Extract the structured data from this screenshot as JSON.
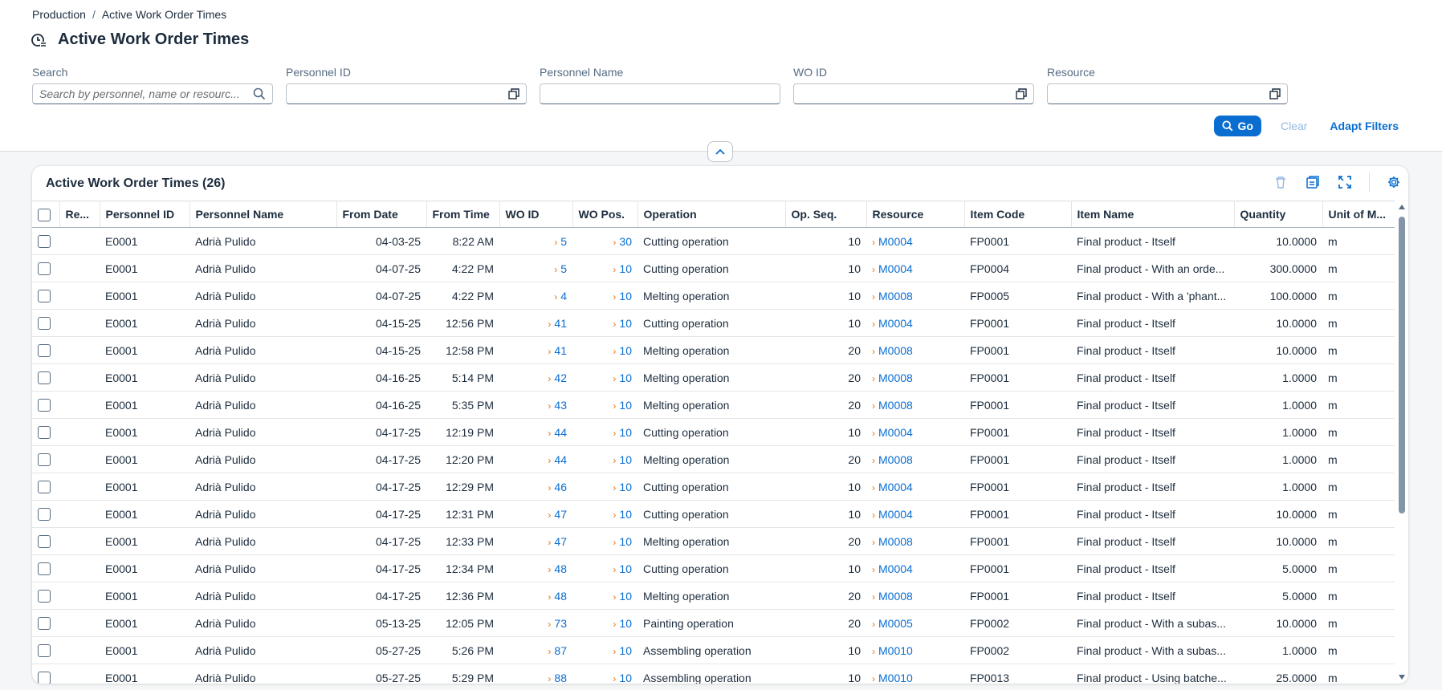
{
  "breadcrumb": {
    "parent": "Production",
    "separator": "/",
    "current": "Active Work Order Times"
  },
  "page": {
    "title": "Active Work Order Times"
  },
  "filters": {
    "search": {
      "label": "Search",
      "placeholder": "Search by personnel, name or resourc..."
    },
    "personnel_id": {
      "label": "Personnel ID",
      "value": ""
    },
    "personnel_name": {
      "label": "Personnel Name",
      "value": ""
    },
    "wo_id": {
      "label": "WO ID",
      "value": ""
    },
    "resource": {
      "label": "Resource",
      "value": ""
    }
  },
  "actions": {
    "go": "Go",
    "clear": "Clear",
    "adapt": "Adapt Filters"
  },
  "table": {
    "title": "Active Work Order Times (26)",
    "columns": [
      "Re...",
      "Personnel ID",
      "Personnel Name",
      "From Date",
      "From Time",
      "WO ID",
      "WO Pos.",
      "Operation",
      "Op. Seq.",
      "Resource",
      "Item Code",
      "Item Name",
      "Quantity",
      "Unit of M..."
    ],
    "rows": [
      {
        "re": "",
        "pid": "E0001",
        "pname": "Adrià Pulido",
        "date": "04-03-25",
        "time": "8:22 AM",
        "wo": "5",
        "pos": "30",
        "op": "Cutting operation",
        "seq": "10",
        "res": "M0004",
        "code": "FP0001",
        "item": "Final product - Itself",
        "qty": "10.0000",
        "uom": "m"
      },
      {
        "re": "",
        "pid": "E0001",
        "pname": "Adrià Pulido",
        "date": "04-07-25",
        "time": "4:22 PM",
        "wo": "5",
        "pos": "10",
        "op": "Cutting operation",
        "seq": "10",
        "res": "M0004",
        "code": "FP0004",
        "item": "Final product - With an orde...",
        "qty": "300.0000",
        "uom": "m"
      },
      {
        "re": "",
        "pid": "E0001",
        "pname": "Adrià Pulido",
        "date": "04-07-25",
        "time": "4:22 PM",
        "wo": "4",
        "pos": "10",
        "op": "Melting operation",
        "seq": "10",
        "res": "M0008",
        "code": "FP0005",
        "item": "Final product - With a 'phant...",
        "qty": "100.0000",
        "uom": "m"
      },
      {
        "re": "",
        "pid": "E0001",
        "pname": "Adrià Pulido",
        "date": "04-15-25",
        "time": "12:56 PM",
        "wo": "41",
        "pos": "10",
        "op": "Cutting operation",
        "seq": "10",
        "res": "M0004",
        "code": "FP0001",
        "item": "Final product - Itself",
        "qty": "10.0000",
        "uom": "m"
      },
      {
        "re": "",
        "pid": "E0001",
        "pname": "Adrià Pulido",
        "date": "04-15-25",
        "time": "12:58 PM",
        "wo": "41",
        "pos": "10",
        "op": "Melting operation",
        "seq": "20",
        "res": "M0008",
        "code": "FP0001",
        "item": "Final product - Itself",
        "qty": "10.0000",
        "uom": "m"
      },
      {
        "re": "",
        "pid": "E0001",
        "pname": "Adrià Pulido",
        "date": "04-16-25",
        "time": "5:14 PM",
        "wo": "42",
        "pos": "10",
        "op": "Melting operation",
        "seq": "20",
        "res": "M0008",
        "code": "FP0001",
        "item": "Final product - Itself",
        "qty": "1.0000",
        "uom": "m"
      },
      {
        "re": "",
        "pid": "E0001",
        "pname": "Adrià Pulido",
        "date": "04-16-25",
        "time": "5:35 PM",
        "wo": "43",
        "pos": "10",
        "op": "Melting operation",
        "seq": "20",
        "res": "M0008",
        "code": "FP0001",
        "item": "Final product - Itself",
        "qty": "1.0000",
        "uom": "m"
      },
      {
        "re": "",
        "pid": "E0001",
        "pname": "Adrià Pulido",
        "date": "04-17-25",
        "time": "12:19 PM",
        "wo": "44",
        "pos": "10",
        "op": "Cutting operation",
        "seq": "10",
        "res": "M0004",
        "code": "FP0001",
        "item": "Final product - Itself",
        "qty": "1.0000",
        "uom": "m"
      },
      {
        "re": "",
        "pid": "E0001",
        "pname": "Adrià Pulido",
        "date": "04-17-25",
        "time": "12:20 PM",
        "wo": "44",
        "pos": "10",
        "op": "Melting operation",
        "seq": "20",
        "res": "M0008",
        "code": "FP0001",
        "item": "Final product - Itself",
        "qty": "1.0000",
        "uom": "m"
      },
      {
        "re": "",
        "pid": "E0001",
        "pname": "Adrià Pulido",
        "date": "04-17-25",
        "time": "12:29 PM",
        "wo": "46",
        "pos": "10",
        "op": "Cutting operation",
        "seq": "10",
        "res": "M0004",
        "code": "FP0001",
        "item": "Final product - Itself",
        "qty": "1.0000",
        "uom": "m"
      },
      {
        "re": "",
        "pid": "E0001",
        "pname": "Adrià Pulido",
        "date": "04-17-25",
        "time": "12:31 PM",
        "wo": "47",
        "pos": "10",
        "op": "Cutting operation",
        "seq": "10",
        "res": "M0004",
        "code": "FP0001",
        "item": "Final product - Itself",
        "qty": "10.0000",
        "uom": "m"
      },
      {
        "re": "",
        "pid": "E0001",
        "pname": "Adrià Pulido",
        "date": "04-17-25",
        "time": "12:33 PM",
        "wo": "47",
        "pos": "10",
        "op": "Melting operation",
        "seq": "20",
        "res": "M0008",
        "code": "FP0001",
        "item": "Final product - Itself",
        "qty": "10.0000",
        "uom": "m"
      },
      {
        "re": "",
        "pid": "E0001",
        "pname": "Adrià Pulido",
        "date": "04-17-25",
        "time": "12:34 PM",
        "wo": "48",
        "pos": "10",
        "op": "Cutting operation",
        "seq": "10",
        "res": "M0004",
        "code": "FP0001",
        "item": "Final product - Itself",
        "qty": "5.0000",
        "uom": "m"
      },
      {
        "re": "",
        "pid": "E0001",
        "pname": "Adrià Pulido",
        "date": "04-17-25",
        "time": "12:36 PM",
        "wo": "48",
        "pos": "10",
        "op": "Melting operation",
        "seq": "20",
        "res": "M0008",
        "code": "FP0001",
        "item": "Final product - Itself",
        "qty": "5.0000",
        "uom": "m"
      },
      {
        "re": "",
        "pid": "E0001",
        "pname": "Adrià Pulido",
        "date": "05-13-25",
        "time": "12:05 PM",
        "wo": "73",
        "pos": "10",
        "op": "Painting operation",
        "seq": "20",
        "res": "M0005",
        "code": "FP0002",
        "item": "Final product - With a subas...",
        "qty": "10.0000",
        "uom": "m"
      },
      {
        "re": "",
        "pid": "E0001",
        "pname": "Adrià Pulido",
        "date": "05-27-25",
        "time": "5:26 PM",
        "wo": "87",
        "pos": "10",
        "op": "Assembling operation",
        "seq": "10",
        "res": "M0010",
        "code": "FP0002",
        "item": "Final product - With a subas...",
        "qty": "1.0000",
        "uom": "m"
      },
      {
        "re": "",
        "pid": "E0001",
        "pname": "Adrià Pulido",
        "date": "05-27-25",
        "time": "5:29 PM",
        "wo": "88",
        "pos": "10",
        "op": "Assembling operation",
        "seq": "10",
        "res": "M0010",
        "code": "FP0013",
        "item": "Final product - Using batche...",
        "qty": "25.0000",
        "uom": "m"
      }
    ]
  },
  "icons": {
    "title": "time-entry-icon",
    "search": "search-icon",
    "value_help": "value-help-icon",
    "collapse": "chevron-up-icon",
    "delete": "delete-icon",
    "export": "export-icon",
    "fullscreen": "fullscreen-icon",
    "settings": "settings-icon",
    "link_chevron": "chevron-right-icon"
  },
  "colors": {
    "accent": "#0a6ed1",
    "link_chevron": "#e9730c",
    "text": "#1d2d3e"
  }
}
